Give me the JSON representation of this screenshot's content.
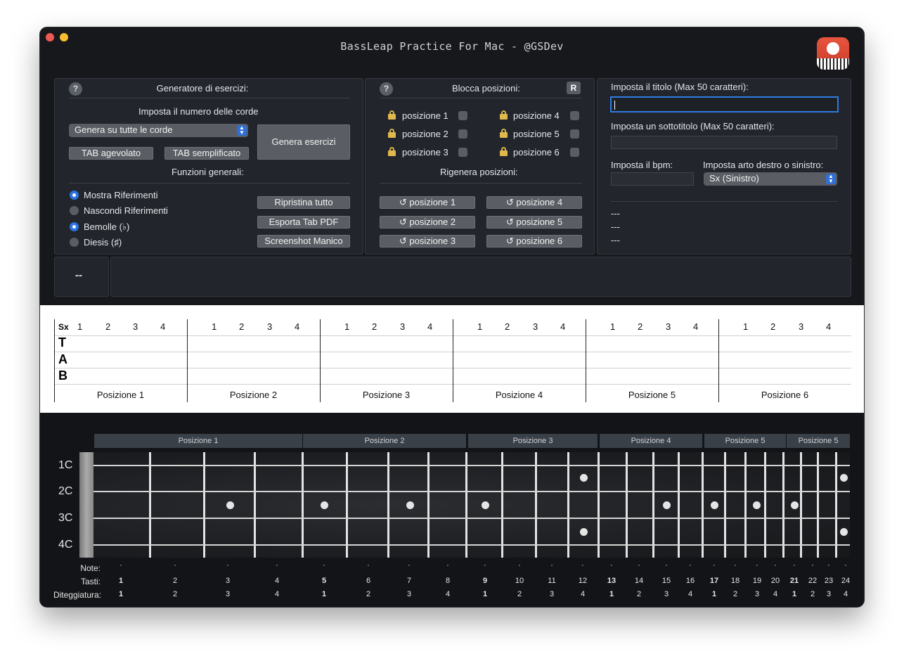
{
  "window": {
    "title": "BassLeap Practice For Mac - @GSDev",
    "app_icon": "bass-player-app-icon"
  },
  "generator": {
    "title": "Generatore di esercizi:",
    "string_count_label": "Imposta il numero delle corde",
    "string_popup": "Genera su tutte le corde",
    "tab_easy": "TAB agevolato",
    "tab_simple": "TAB semplificato",
    "generate": "Genera esercizi",
    "general_label": "Funzioni generali:",
    "radios": [
      {
        "label": "Mostra Riferimenti",
        "selected": true
      },
      {
        "label": "Nascondi Riferimenti",
        "selected": false
      },
      {
        "label": "Bemolle (♭)",
        "selected": true
      },
      {
        "label": "Diesis (♯)",
        "selected": false
      }
    ],
    "reset_all": "Ripristina tutto",
    "export_pdf": "Esporta Tab PDF",
    "screenshot": "Screenshot Manico"
  },
  "lock": {
    "title": "Blocca posizioni:",
    "reset": "R",
    "positions": [
      "posizione 1",
      "posizione 2",
      "posizione 3",
      "posizione 4",
      "posizione 5",
      "posizione 6"
    ],
    "regen_title": "Rigenera posizioni:",
    "regen": [
      "↺ posizione 1",
      "↺ posizione 2",
      "↺ posizione 3",
      "↺ posizione 4",
      "↺ posizione 5",
      "↺ posizione 6"
    ]
  },
  "settings": {
    "title_label": "Imposta il titolo (Max 50 caratteri):",
    "title_value": "",
    "subtitle_label": "Imposta un sottotitolo (Max 50 caratteri):",
    "subtitle_value": "",
    "bpm_label": "Imposta il bpm:",
    "bpm_value": "",
    "hand_label": "Imposta arto destro o sinistro:",
    "hand_value": "Sx (Sinistro)",
    "info": [
      "---",
      "---",
      "---"
    ]
  },
  "status": {
    "left": "--",
    "right": ""
  },
  "tab": {
    "hand": "Sx",
    "letters": [
      "T",
      "A",
      "B"
    ],
    "fingers": [
      "1",
      "2",
      "3",
      "4"
    ],
    "positions": [
      "Posizione 1",
      "Posizione 2",
      "Posizione 3",
      "Posizione 4",
      "Posizione 5",
      "Posizione 6"
    ]
  },
  "fretboard": {
    "headers": [
      "Posizione 1",
      "Posizione 2",
      "Posizione 3",
      "Posizione 4",
      "Posizione 5",
      "Posizione 5"
    ],
    "strings": [
      "1C",
      "2C",
      "3C",
      "4C"
    ],
    "row_labels": {
      "notes": "Note:",
      "frets": "Tasti:",
      "fingering": "Diteggiatura:"
    },
    "notes": [
      "·",
      "·",
      "·",
      "·",
      "·",
      "·",
      "·",
      "·",
      "·",
      "·",
      "·",
      "·",
      "·",
      "·",
      "·",
      "·",
      "·",
      "·",
      "·",
      "·",
      "·",
      "·",
      "·",
      "·"
    ],
    "frets": [
      "1",
      "2",
      "3",
      "4",
      "5",
      "6",
      "7",
      "8",
      "9",
      "10",
      "11",
      "12",
      "13",
      "14",
      "15",
      "16",
      "17",
      "18",
      "19",
      "20",
      "21",
      "22",
      "23",
      "24"
    ],
    "fingering": [
      "1",
      "2",
      "3",
      "4",
      "1",
      "2",
      "3",
      "4",
      "1",
      "2",
      "3",
      "4",
      "1",
      "2",
      "3",
      "4",
      "1",
      "2",
      "3",
      "4",
      "1",
      "2",
      "3",
      "4"
    ],
    "bold_index": [
      0,
      4,
      8,
      12,
      16,
      20
    ]
  }
}
